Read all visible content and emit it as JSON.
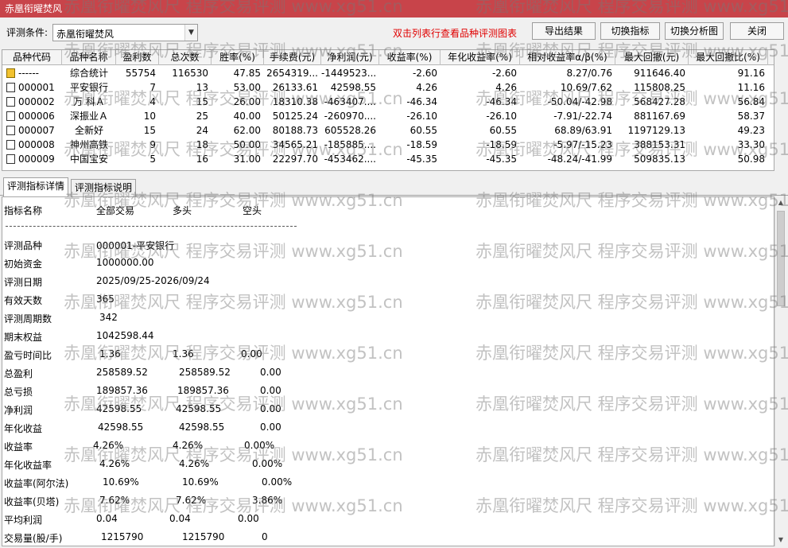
{
  "window": {
    "title": "赤凰衔曜焚风"
  },
  "toolbar": {
    "condition_label": "评测条件:",
    "condition_value": "赤凰衔曜焚风",
    "hint": "双击列表行查看品种评测图表",
    "buttons": [
      "导出结果",
      "切换指标",
      "切换分析图",
      "关闭"
    ]
  },
  "grid": {
    "headers": [
      "品种代码",
      "品种名称",
      "盈利数",
      "总次数",
      "胜率(%)",
      "手续费(元)",
      "净利润(元)",
      "收益率(%)",
      "年化收益率(%)",
      "相对收益率α/β(%)",
      "最大回撤(元)",
      "最大回撤比(%)"
    ],
    "rows": [
      {
        "code": "------",
        "name": "综合统计",
        "wins": "55754",
        "total": "116530",
        "winrate": "47.85",
        "fee": "2654319...",
        "profit": "-1449523...",
        "ret": "-2.60",
        "annual": "-2.60",
        "rel": "8.27/0.76",
        "maxdd": "911646.40",
        "maxddp": "91.16",
        "summary": true
      },
      {
        "code": "000001",
        "name": "平安银行",
        "wins": "7",
        "total": "13",
        "winrate": "53.00",
        "fee": "26133.61",
        "profit": "42598.55",
        "ret": "4.26",
        "annual": "4.26",
        "rel": "10.69/7.62",
        "maxdd": "115808.25",
        "maxddp": "11.16"
      },
      {
        "code": "000002",
        "name": "万 科Ａ",
        "wins": "4",
        "total": "15",
        "winrate": "26.00",
        "fee": "18310.38",
        "profit": "-463407....",
        "ret": "-46.34",
        "annual": "-46.34",
        "rel": "-50.04/-42.98",
        "maxdd": "568427.28",
        "maxddp": "56.84"
      },
      {
        "code": "000006",
        "name": "深振业Ａ",
        "wins": "10",
        "total": "25",
        "winrate": "40.00",
        "fee": "50125.24",
        "profit": "-260970....",
        "ret": "-26.10",
        "annual": "-26.10",
        "rel": "-7.91/-22.74",
        "maxdd": "881167.69",
        "maxddp": "58.37"
      },
      {
        "code": "000007",
        "name": "全新好",
        "wins": "15",
        "total": "24",
        "winrate": "62.00",
        "fee": "80188.73",
        "profit": "605528.26",
        "ret": "60.55",
        "annual": "60.55",
        "rel": "68.89/63.91",
        "maxdd": "1197129.13",
        "maxddp": "49.23"
      },
      {
        "code": "000008",
        "name": "神州高铁",
        "wins": "9",
        "total": "18",
        "winrate": "50.00",
        "fee": "34565.21",
        "profit": "-185885....",
        "ret": "-18.59",
        "annual": "-18.59",
        "rel": "-5.97/-15.23",
        "maxdd": "388153.31",
        "maxddp": "33.30"
      },
      {
        "code": "000009",
        "name": "中国宝安",
        "wins": "5",
        "total": "16",
        "winrate": "31.00",
        "fee": "22297.70",
        "profit": "-453462....",
        "ret": "-45.35",
        "annual": "-45.35",
        "rel": "-48.24/-41.99",
        "maxdd": "509835.13",
        "maxddp": "50.98"
      }
    ]
  },
  "tabs": [
    "评测指标详情",
    "评测指标说明"
  ],
  "detail": {
    "header": [
      "指标名称",
      "全部交易",
      "多头",
      "空头"
    ],
    "separator": "------------------------------------------------------------------------",
    "info": [
      {
        "label": "评测品种",
        "value": "000001-平安银行"
      },
      {
        "label": "初始资金",
        "value": "1000000.00"
      },
      {
        "label": "评测日期",
        "value": "2025/09/25-2026/09/24"
      },
      {
        "label": "有效天数",
        "value": "365"
      },
      {
        "label": "评测周期数",
        "value": "342"
      },
      {
        "label": "期末权益",
        "value": "1042598.44"
      }
    ],
    "stats": [
      {
        "label": "盈亏时间比",
        "all": "1.36",
        "long": "1.36",
        "short": "0.00"
      },
      {
        "label": "总盈利",
        "all": "258589.52",
        "long": "258589.52",
        "short": "0.00"
      },
      {
        "label": "总亏损",
        "all": "189857.36",
        "long": "189857.36",
        "short": "0.00"
      },
      {
        "label": "净利润",
        "all": "42598.55",
        "long": "42598.55",
        "short": "0.00"
      },
      {
        "label": "年化收益",
        "all": "42598.55",
        "long": "42598.55",
        "short": "0.00"
      },
      {
        "label": "收益率",
        "all": "4.26%",
        "long": "4.26%",
        "short": "0.00%"
      },
      {
        "label": "年化收益率",
        "all": "4.26%",
        "long": "4.26%",
        "short": "0.00%"
      },
      {
        "label": "收益率(阿尔法)",
        "all": "10.69%",
        "long": "10.69%",
        "short": "0.00%"
      },
      {
        "label": "收益率(贝塔)",
        "all": "7.62%",
        "long": "7.62%",
        "short": "3.86%"
      },
      {
        "label": "平均利润",
        "all": "0.04",
        "long": "0.04",
        "short": "0.00"
      },
      {
        "label": "交易量(股/手)",
        "all": "1215790",
        "long": "1215790",
        "short": "0"
      }
    ]
  },
  "watermark": {
    "text": "赤凰衔曜焚风尺 程序交易评测 www.xg51.cn"
  }
}
